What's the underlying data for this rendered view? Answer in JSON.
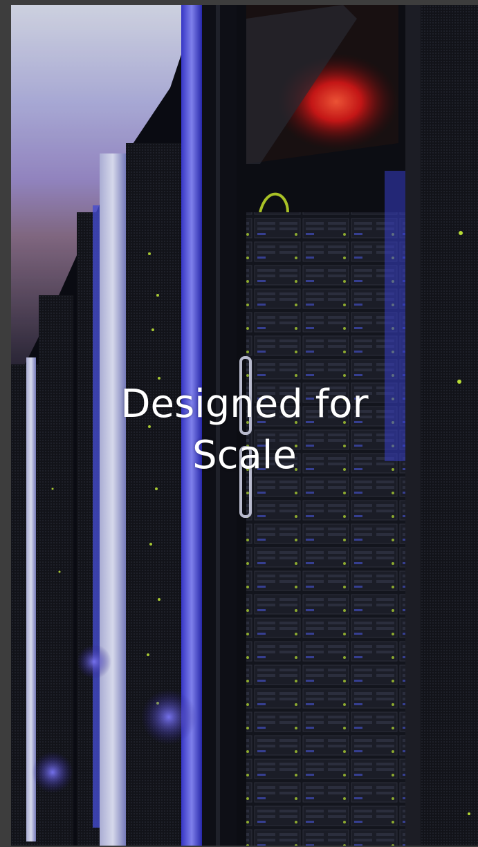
{
  "slide": {
    "title_line1": "Designed for",
    "title_line2": "Scale"
  },
  "colors": {
    "frame": "#3d3d3d",
    "text": "#ffffff",
    "rack_glow_blue": "#5a4bff",
    "alert_red": "#ff2a1a",
    "led_green": "#c8f03a"
  },
  "image": {
    "subject": "server-racks-photo"
  }
}
